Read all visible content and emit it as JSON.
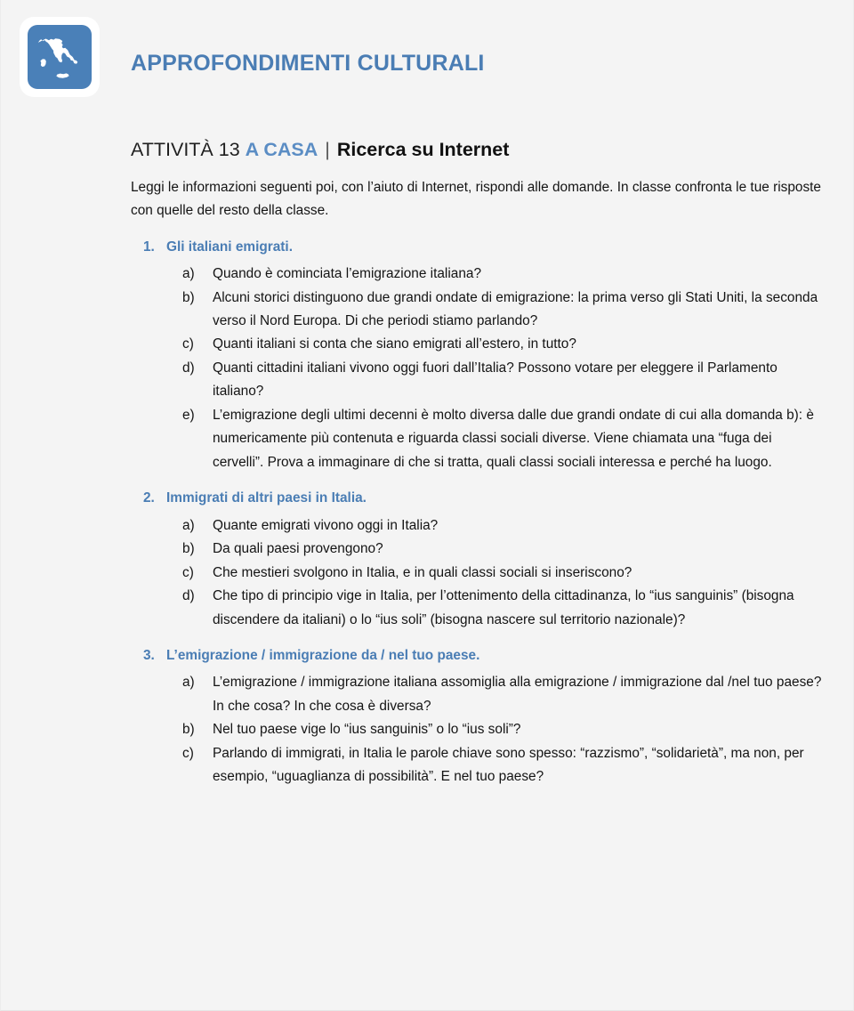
{
  "header": {
    "logo_icon": "italy-map-icon",
    "title": "APPROFONDIMENTI CULTURALI",
    "accent_color": "#4a7db4",
    "logo_color": "#4a80b8"
  },
  "activity": {
    "label": "ATTIVITÀ 13",
    "accent": "A CASA",
    "separator": "|",
    "subtitle": "Ricerca su Internet"
  },
  "intro": "Leggi le informazioni seguenti poi, con l’aiuto di Internet, rispondi alle domande. In classe confronta le tue risposte con quelle del resto della classe.",
  "sections": [
    {
      "number": "1.",
      "heading": "Gli italiani emigrati.",
      "questions": [
        {
          "marker": "a)",
          "text": "Quando è cominciata l’emigrazione italiana?"
        },
        {
          "marker": "b)",
          "text": "Alcuni storici distinguono due grandi ondate di emigrazione: la prima verso gli Stati Uniti, la seconda verso il Nord Europa. Di che periodi stiamo parlando?"
        },
        {
          "marker": "c)",
          "text": "Quanti italiani si conta che siano emigrati all’estero, in tutto?"
        },
        {
          "marker": "d)",
          "text": "Quanti cittadini italiani vivono oggi fuori dall’Italia? Possono votare per eleggere il Parlamento italiano?"
        },
        {
          "marker": "e)",
          "text": "L’emigrazione degli ultimi decenni è molto diversa dalle due grandi ondate di cui alla domanda b): è numericamente più contenuta e riguarda classi sociali diverse. Viene chiamata una “fuga dei cervelli”. Prova a immaginare di che si tratta, quali classi  sociali interessa e perché ha luogo."
        }
      ]
    },
    {
      "number": "2.",
      "heading": "Immigrati di altri paesi in Italia.",
      "questions": [
        {
          "marker": "a)",
          "text": "Quante emigrati vivono oggi in Italia?"
        },
        {
          "marker": "b)",
          "text": "Da quali paesi provengono?"
        },
        {
          "marker": "c)",
          "text": "Che mestieri svolgono in Italia, e in quali classi sociali si inseriscono?"
        },
        {
          "marker": "d)",
          "text": "Che tipo di principio vige in Italia, per l’ottenimento della cittadinanza, lo “ius sanguinis” (bisogna discendere da italiani) o lo “ius soli” (bisogna nascere sul territorio nazionale)?"
        }
      ]
    },
    {
      "number": "3.",
      "heading": "L’emigrazione / immigrazione da / nel tuo paese.",
      "questions": [
        {
          "marker": "a)",
          "text": "L’emigrazione / immigrazione italiana assomiglia alla emigrazione / immigrazione dal /nel tuo paese? In che cosa? In che cosa è diversa?"
        },
        {
          "marker": "b)",
          "text": "Nel tuo paese vige lo “ius sanguinis” o lo “ius soli”?"
        },
        {
          "marker": "c)",
          "text": "Parlando di immigrati, in Italia le parole chiave sono spesso: “razzismo”, “solidarietà”, ma non, per esempio, “uguaglianza di possibilità”. E nel tuo paese?"
        }
      ]
    }
  ]
}
